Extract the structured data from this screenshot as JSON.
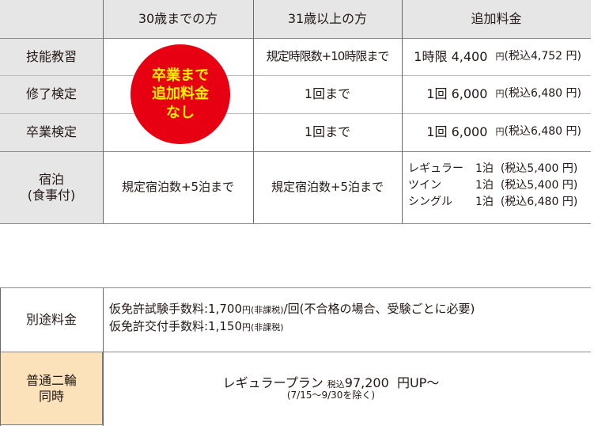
{
  "table1": {
    "headers": [
      "30歳までの方",
      "31歳以上の方",
      "追加料金"
    ],
    "rows": [
      {
        "label": "技能教習",
        "over31": "規定時限数+10時限まで",
        "fee_main": "1時限 4,400",
        "fee_yen": "円",
        "fee_tax": "(税込4,752 円)"
      },
      {
        "label": "修了検定",
        "over31": "1回まで",
        "fee_main": "1回 6,000",
        "fee_yen": "円",
        "fee_tax": "(税込6,480 円)"
      },
      {
        "label": "卒業検定",
        "over31": "1回まで",
        "fee_main": "1回 6,000",
        "fee_yen": "円",
        "fee_tax": "(税込6,480 円)"
      }
    ],
    "badge": [
      "卒業まで",
      "追加料金",
      "なし"
    ],
    "lodging": {
      "label_1": "宿泊",
      "label_2": "(食事付)",
      "under30": "規定宿泊数+5泊まで",
      "over31": "規定宿泊数+5泊まで",
      "rooms": [
        {
          "type": "レギュラー",
          "nights": "1泊",
          "price": "(税込5,400 円)"
        },
        {
          "type": "ツイン",
          "nights": "1泊",
          "price": "(税込5,400 円)"
        },
        {
          "type": "シングル",
          "nights": "1泊",
          "price": "(税込6,480 円)"
        }
      ]
    }
  },
  "table2": {
    "separate": {
      "label": "別途料金",
      "line1_a": "仮免許試験手数料:1,700",
      "line1_b": "円(非課税)",
      "line1_c": "/回(不合格の場合、受験ごとに必要)",
      "line2_a": "仮免許交付手数料:1,150",
      "line2_b": "円(非課税)"
    },
    "bike": {
      "label_1": "普通二輪",
      "label_2": "同時",
      "plan": "レギュラープラン",
      "tax": "税込",
      "price": "97,200",
      "suffix": "円UP〜",
      "note": "(7/15〜9/30を除く)"
    }
  },
  "colors": {
    "badge": "#e60012",
    "badge_text": "#fff100",
    "header_bg": "#e6e6e6",
    "bike_bg": "#fbe2bb"
  }
}
